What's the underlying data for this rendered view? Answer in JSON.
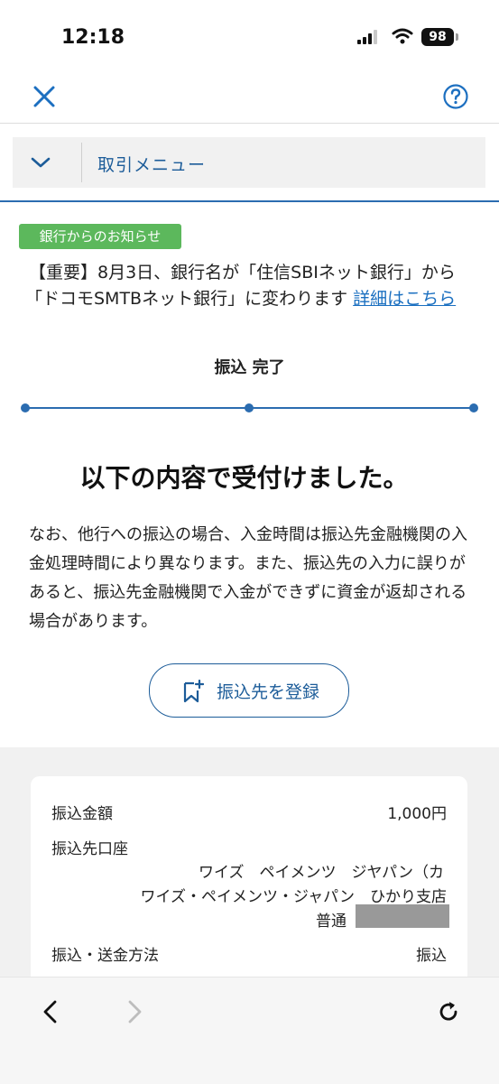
{
  "status_bar": {
    "time": "12:18",
    "battery": "98"
  },
  "header": {
    "close_icon": "close-icon",
    "help_icon": "help-icon"
  },
  "menu": {
    "label": "取引メニュー",
    "icon": "chevron-down-icon"
  },
  "notice": {
    "badge": "銀行からのお知らせ",
    "line1": "【重要】8月3日、銀行名が「住信SBIネット銀行」から",
    "line2": "「ドコモSMTBネット銀行」に変わります",
    "link": "詳細はこちら"
  },
  "progress": {
    "title": "振込 完了",
    "current_step": 3,
    "total_steps": 3
  },
  "result": {
    "heading": "以下の内容で受付けました。",
    "body": "なお、他行への振込の場合、入金時間は振込先金融機関の入金処理時間により異なります。また、振込先の入力に誤りがあると、振込先金融機関で入金ができずに資金が返却される場合があります。"
  },
  "register_button": {
    "label": "振込先を登録",
    "icon": "bookmark-add-icon"
  },
  "details": {
    "amount_label": "振込金額",
    "amount_value": "1,000円",
    "account_label": "振込先口座",
    "account_name_kana": "ワイズ　ペイメンツ　ジヤパン（カ",
    "account_name": "ワイズ・ペイメンツ・ジャパン　ひかり支店",
    "account_type": "普通",
    "method_label": "振込・送金方法",
    "method_value": "振込"
  },
  "browser_nav": {
    "back_icon": "back-icon",
    "forward_icon": "forward-icon",
    "reload_icon": "reload-icon"
  },
  "colors": {
    "accent": "#1c5c99",
    "notice_badge": "#5cb85c",
    "link": "#1a6fc0"
  }
}
